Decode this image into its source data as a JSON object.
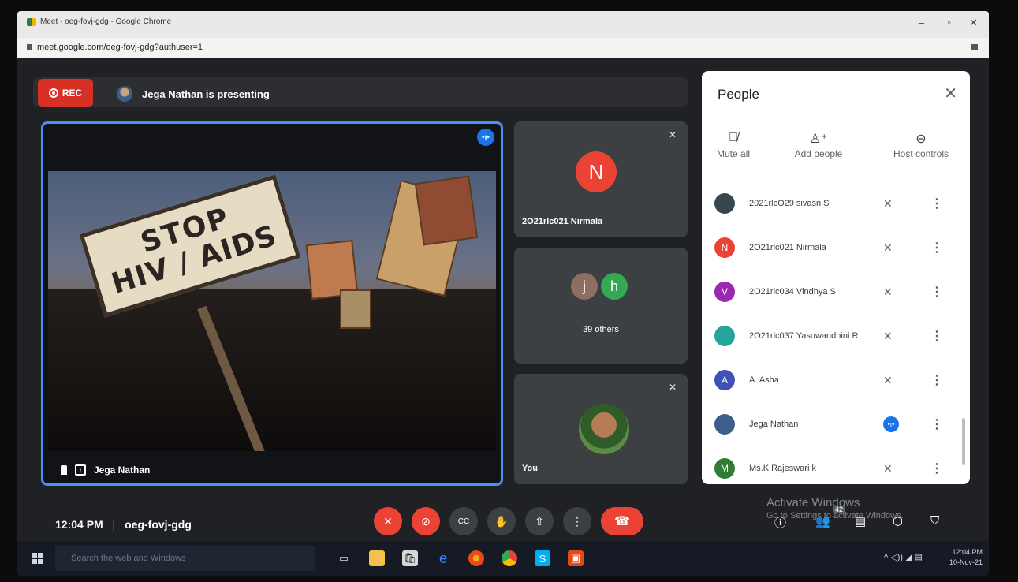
{
  "browser": {
    "tab_title": "Meet - oeg-fovj-gdg - Google Chrome",
    "url": "meet.google.com/oeg-fovj-gdg?authuser=1",
    "minimize": "–",
    "maximize": "▫",
    "close": "✕"
  },
  "meet": {
    "rec_label": "REC",
    "presenting_text": "Jega Nathan is presenting",
    "main_tile": {
      "name": "Jega Nathan",
      "sign_line1": "STOP",
      "sign_line2": "HIV / AIDS"
    },
    "side_tiles": [
      {
        "initial": "N",
        "name": "2O21rlc021 Nirmala",
        "color": "#ea4335"
      },
      {
        "avatar1": "j",
        "avatar2": "h",
        "caption": "39 others",
        "color1": "#8d6e63",
        "color2": "#34a853"
      },
      {
        "name": "You"
      }
    ],
    "bottom": {
      "time": "12:04 PM",
      "separator": "|",
      "meeting_code": "oeg-fovj-gdg",
      "participant_count": "42"
    },
    "activate_windows": {
      "line1": "Activate Windows",
      "line2": "Go to Settings to activate Windows."
    }
  },
  "people_panel": {
    "title": "People",
    "actions": [
      {
        "label": "Mute all",
        "icon": "mic-off-icon"
      },
      {
        "label": "Add people",
        "icon": "add-person-icon"
      },
      {
        "label": "Host controls",
        "icon": "toggle-icon"
      }
    ],
    "participants": [
      {
        "name": "2021rlcO29 sivasri S",
        "initial": "",
        "color": "#37474f",
        "status": "muted"
      },
      {
        "name": "2O21rlc021 Nirmala",
        "initial": "N",
        "color": "#ea4335",
        "status": "muted"
      },
      {
        "name": "2O21rlc034 Vindhya S",
        "initial": "V",
        "color": "#9c27b0",
        "status": "muted"
      },
      {
        "name": "2O21rlc037 Yasuwandhini R",
        "initial": "",
        "color": "#26a69a",
        "status": "muted"
      },
      {
        "name": "A. Asha",
        "initial": "A",
        "color": "#3f51b5",
        "status": "muted"
      },
      {
        "name": "Jega Nathan",
        "initial": "",
        "color": "#3b5f8a",
        "status": "speaking"
      },
      {
        "name": "Ms.K.Rajeswari k",
        "initial": "M",
        "color": "#2e7d32",
        "status": "muted"
      }
    ]
  },
  "taskbar": {
    "search_placeholder": "Search the web and Windows",
    "clock_time": "12:04 PM",
    "clock_date": "10-Nov-21"
  },
  "colors": {
    "accent_blue": "#1a73e8",
    "danger_red": "#ea4335",
    "meet_bg": "#202124"
  }
}
